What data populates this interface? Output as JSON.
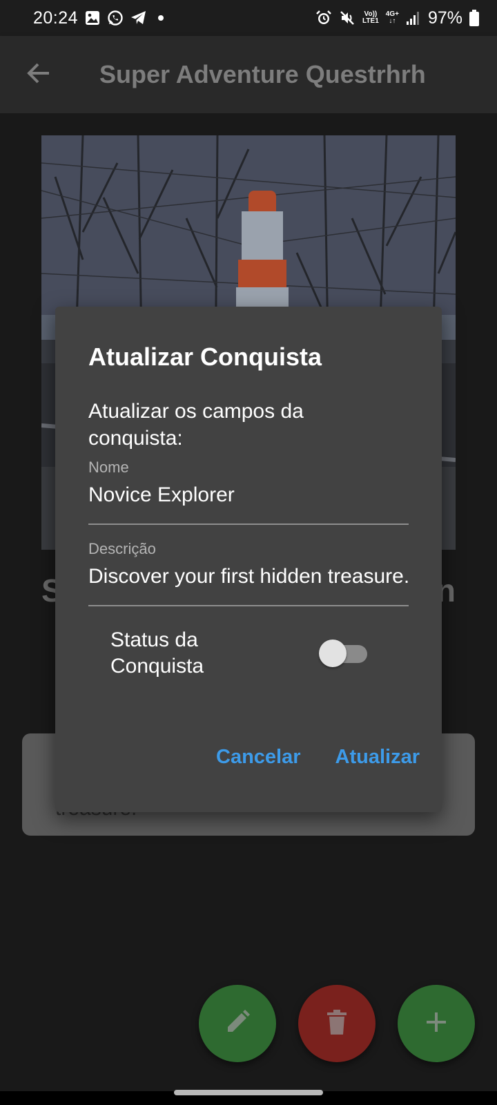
{
  "status_bar": {
    "time": "20:24",
    "battery": "97%",
    "network": "VoLTE 4G+",
    "left_icons": [
      "gallery-icon",
      "whatsapp-icon",
      "telegram-icon",
      "dot-icon"
    ],
    "right_icons": [
      "alarm-icon",
      "mute-icon",
      "volte-icon",
      "4g-icon",
      "signal-icon",
      "battery-icon"
    ]
  },
  "app_bar": {
    "title": "Super Adventure Questrhrh",
    "back_icon": "arrow-back-icon"
  },
  "background": {
    "title_partial_left": "S",
    "title_partial_right": "n",
    "card_text": "treasure."
  },
  "dialog": {
    "title": "Atualizar Conquista",
    "subtitle": "Atualizar os campos da conquista:",
    "name_label": "Nome",
    "name_value": "Novice Explorer",
    "description_label": "Descrição",
    "description_value": "Discover your first hidden treasure.",
    "status_label": "Status da Conquista",
    "status_enabled": false,
    "cancel_label": "Cancelar",
    "update_label": "Atualizar"
  },
  "fabs": {
    "edit_icon": "pencil-icon",
    "delete_icon": "trash-icon",
    "add_icon": "plus-icon"
  },
  "colors": {
    "accent": "#3d9be9",
    "fab_green": "#2e6a30",
    "fab_red": "#7a211d",
    "dialog_bg": "#424242"
  }
}
